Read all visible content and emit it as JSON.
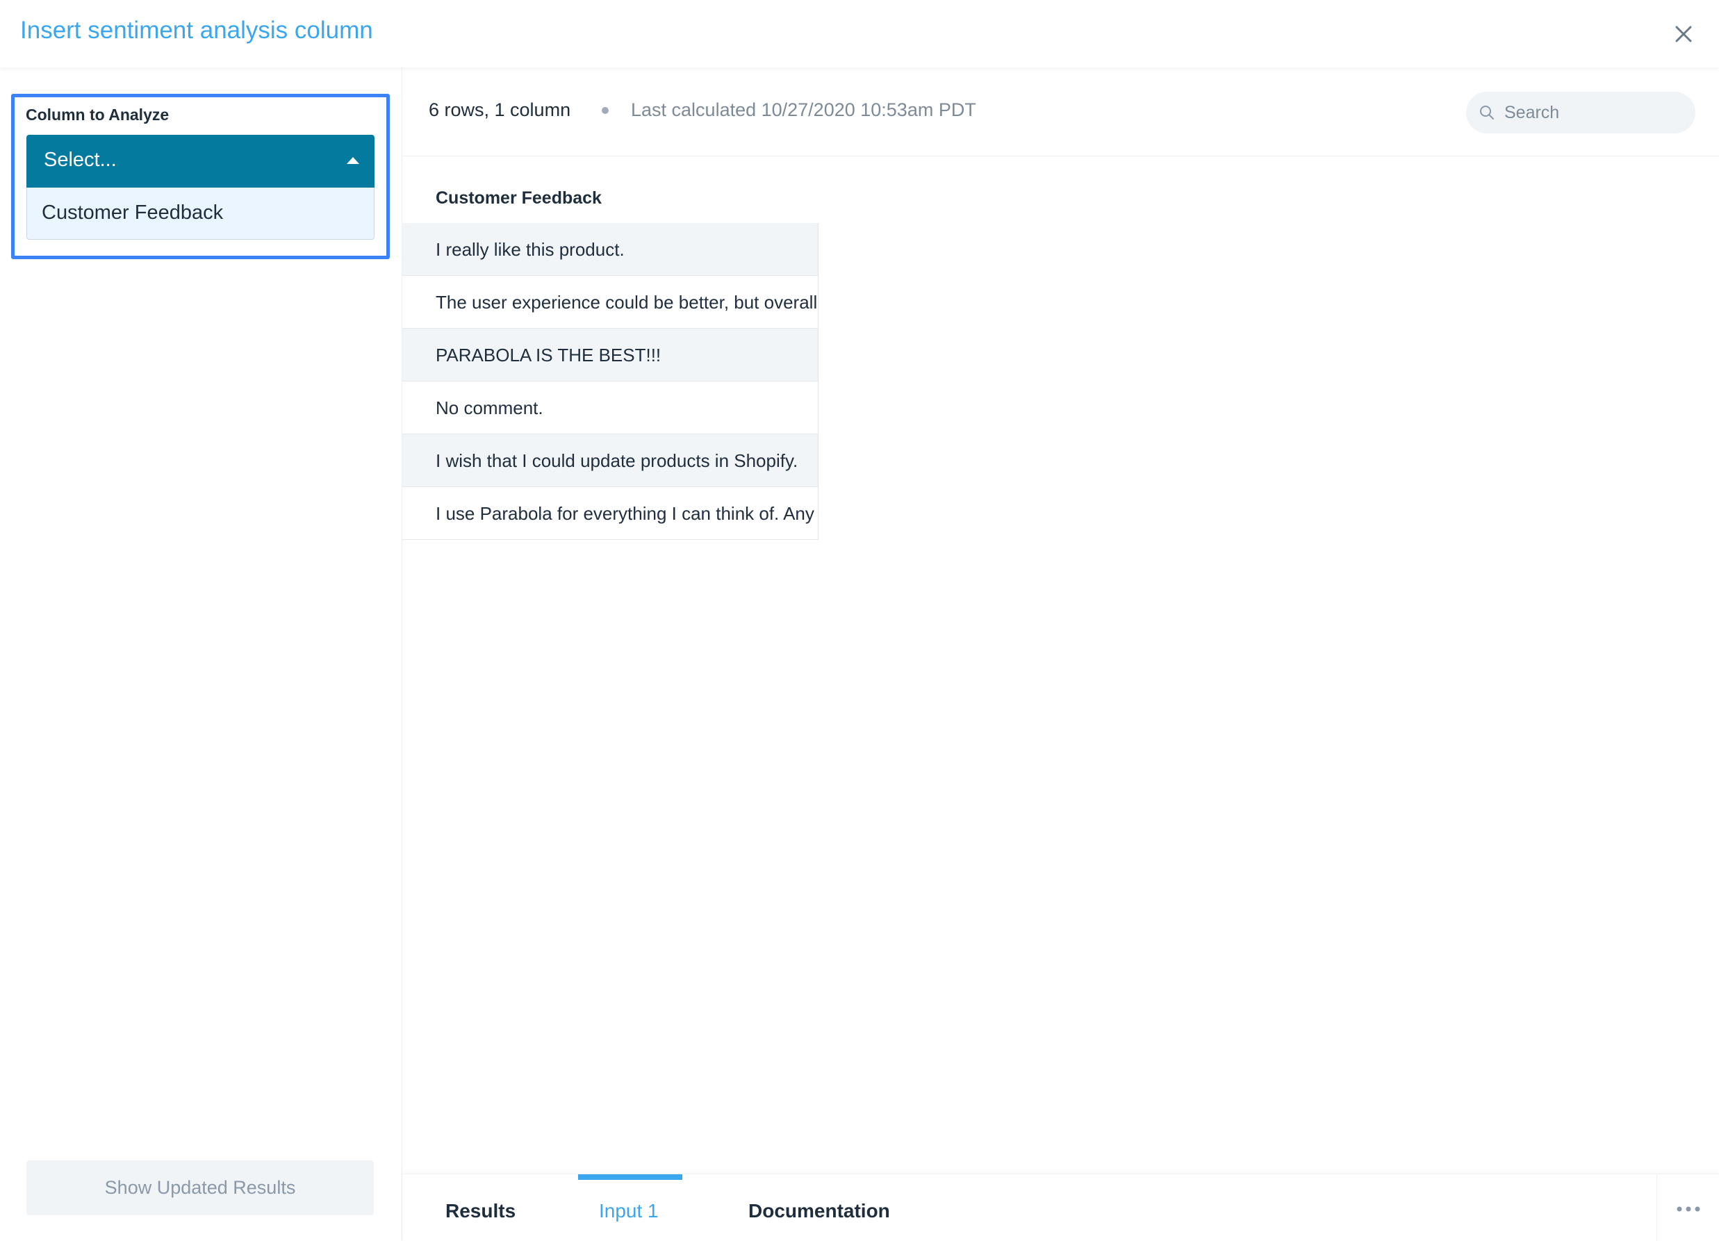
{
  "header": {
    "title": "Insert sentiment analysis column",
    "close_icon": "close-icon"
  },
  "sidebar": {
    "field_label": "Column to Analyze",
    "select": {
      "value": "Select...",
      "options": [
        "Customer Feedback"
      ]
    },
    "show_button_label": "Show Updated Results"
  },
  "main": {
    "rows_info": "6 rows, 1 column",
    "last_calculated": "Last calculated 10/27/2020 10:53am PDT",
    "search": {
      "placeholder": "Search",
      "icon": "search-icon"
    },
    "table": {
      "column_header": "Customer Feedback",
      "rows": [
        "I really like this product.",
        "The user experience could be better, but overall",
        "PARABOLA IS THE BEST!!!",
        "No comment.",
        "I wish that I could update products in Shopify.",
        "I use Parabola for everything I can think of. Any"
      ]
    }
  },
  "tabs": {
    "items": [
      "Results",
      "Input 1",
      "Documentation"
    ],
    "active": "Input 1",
    "more_icon": "more-horizontal-icon"
  },
  "colors": {
    "accent": "#3aa6ee",
    "select_bg": "#057a9f",
    "focus_outline": "#3b82f6"
  }
}
